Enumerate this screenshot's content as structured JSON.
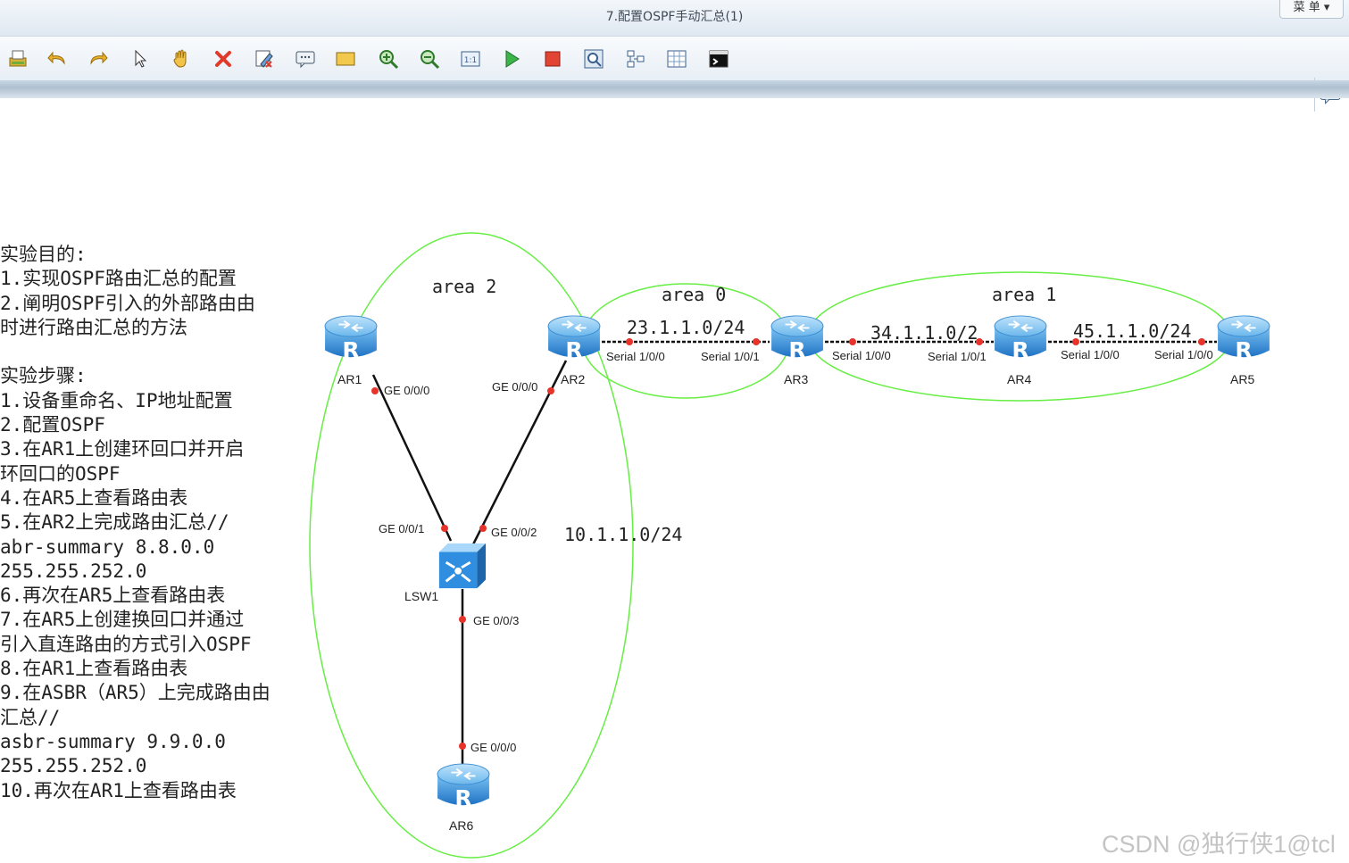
{
  "window": {
    "title": "7.配置OSPF手动汇总(1)",
    "menu_label": "菜 单"
  },
  "toolbar": {
    "icons": [
      "print-icon",
      "undo-icon",
      "redo-icon",
      "select-pointer-icon",
      "hand-pan-icon",
      "delete-icon",
      "clear-edit-icon",
      "text-note-icon",
      "rectangle-icon",
      "zoom-in-icon",
      "zoom-out-icon",
      "fit-view-icon",
      "start-device-icon",
      "stop-device-icon",
      "capture-packet-icon",
      "topology-icon",
      "grid-icon",
      "console-icon"
    ],
    "chat_icon": "chat-icon"
  },
  "notes": [
    "实验目的:",
    "1.实现OSPF路由汇总的配置",
    "2.阐明OSPF引入的外部路由由",
    "时进行路由汇总的方法",
    "",
    "实验步骤:",
    "1.设备重命名、IP地址配置",
    "2.配置OSPF",
    "3.在AR1上创建环回口并开启",
    "环回口的OSPF",
    "4.在AR5上查看路由表",
    "5.在AR2上完成路由汇总//",
    "abr-summary 8.8.0.0",
    "255.255.252.0",
    "6.再次在AR5上查看路由表",
    "7.在AR5上创建换回口并通过",
    "引入直连路由的方式引入OSPF",
    "8.在AR1上查看路由表",
    "9.在ASBR（AR5）上完成路由由",
    "汇总//",
    "asbr-summary 9.9.0.0",
    "255.255.252.0",
    "10.再次在AR1上查看路由表"
  ],
  "topology": {
    "areas": {
      "area2": "area 2",
      "area0": "area 0",
      "area1": "area 1"
    },
    "area_color": "#66ee44",
    "devices": {
      "ar1": "AR1",
      "ar2": "AR2",
      "ar3": "AR3",
      "ar4": "AR4",
      "ar5": "AR5",
      "ar6": "AR6",
      "lsw1": "LSW1"
    },
    "networks": {
      "n23": "23.1.1.0/24",
      "n34": "34.1.1.0/2",
      "n45": "45.1.1.0/24",
      "n10": "10.1.1.0/24"
    },
    "ports": {
      "ar1_ge000": "GE 0/0/0",
      "ar2_ge000": "GE 0/0/0",
      "ar2_s100": "Serial 1/0/0",
      "ar3_s101": "Serial 1/0/1",
      "ar3_s100": "Serial 1/0/0",
      "ar4_s101": "Serial 1/0/1",
      "ar4_s100": "Serial 1/0/0",
      "ar5_s100": "Serial 1/0/0",
      "lsw_ge001": "GE 0/0/1",
      "lsw_ge002": "GE 0/0/2",
      "lsw_ge003": "GE 0/0/3",
      "ar6_ge000": "GE 0/0/0"
    }
  },
  "watermark": "CSDN @独行侠1@tcl"
}
